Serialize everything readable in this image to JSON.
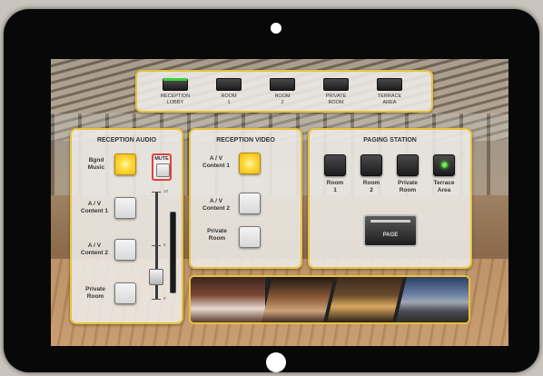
{
  "colors": {
    "accent_border": "#e7c23c",
    "active_yellow": "#ffd83a",
    "led_green": "#39d13a",
    "mute_red": "#e04040",
    "bezel": "#080808"
  },
  "top_bar": {
    "buttons": [
      {
        "label": "RECEPTION\nLOBBY",
        "active": true
      },
      {
        "label": "ROOM\n1",
        "active": false
      },
      {
        "label": "ROOM\n2",
        "active": false
      },
      {
        "label": "PRIVATE\nROOM",
        "active": false
      },
      {
        "label": "TERRACE\nAREA",
        "active": false
      }
    ]
  },
  "reception_audio": {
    "title": "RECEPTION AUDIO",
    "sources": [
      {
        "label": "Bgnd\nMusic",
        "active": true
      },
      {
        "label": "A / V\nContent 1",
        "active": false
      },
      {
        "label": "A / V\nContent 2",
        "active": false
      },
      {
        "label": "Private\nRoom",
        "active": false
      }
    ],
    "mute_label": "MUTE",
    "fader": {
      "scale": [
        "10",
        "5",
        "0"
      ],
      "level": 0.2
    }
  },
  "reception_video": {
    "title": "RECEPTION VIDEO",
    "sources": [
      {
        "label": "A / V\nContent 1",
        "active": true
      },
      {
        "label": "A / V\nContent 2",
        "active": false
      },
      {
        "label": "Private\nRoom",
        "active": false
      }
    ]
  },
  "paging_station": {
    "title": "PAGING STATION",
    "zones": [
      {
        "label": "Room\n1",
        "active": false
      },
      {
        "label": "Room\n2",
        "active": false
      },
      {
        "label": "Private\nRoom",
        "active": false
      },
      {
        "label": "Terrace\nArea",
        "active": true
      }
    ],
    "page_label": "PAGE"
  },
  "photo_strip": {
    "photos": [
      {
        "name": "dining-room-photo"
      },
      {
        "name": "restaurant-photo"
      },
      {
        "name": "bar-photo"
      },
      {
        "name": "terrace-view-photo"
      }
    ]
  }
}
